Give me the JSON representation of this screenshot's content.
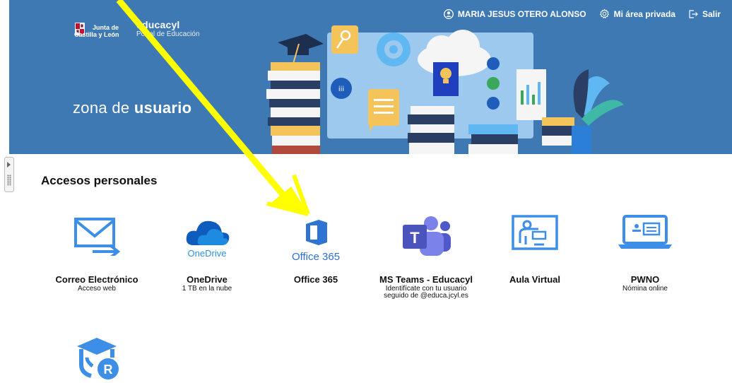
{
  "header": {
    "user_name": "MARIA JESUS OTERO ALONSO",
    "private_area": "Mi área privada",
    "logout": "Salir"
  },
  "logo": {
    "jcyl_line1": "Junta de",
    "jcyl_line2": "Castilla y León",
    "site_name": "educacyl",
    "site_subtitle": "Portal de Educación"
  },
  "zone": {
    "prefix": "zona de",
    "highlight": "usuario"
  },
  "section": {
    "title": "Accesos personales"
  },
  "tiles": [
    {
      "title": "Correo Electrónico",
      "desc": "Acceso web",
      "icon": "mail-forward-icon"
    },
    {
      "title": "OneDrive",
      "desc": "1 TB en la nube",
      "icon": "onedrive-icon",
      "logo_text": "OneDrive"
    },
    {
      "title": "Office 365",
      "desc": "",
      "icon": "office365-icon",
      "logo_text": "Office 365"
    },
    {
      "title": "MS Teams - Educacyl",
      "desc_line1": "Identifícate con tu usuario",
      "desc_line2": "seguido de @educa.jcyl.es",
      "icon": "teams-icon"
    },
    {
      "title": "Aula Virtual",
      "desc": "",
      "icon": "aula-virtual-icon"
    },
    {
      "title": "PWNO",
      "desc": "Nómina online",
      "icon": "pwno-laptop-icon"
    },
    {
      "title": "",
      "desc": "",
      "icon": "graduation-r-icon"
    }
  ],
  "colors": {
    "banner": "#3f79b3",
    "accent_blue": "#2f8fdc",
    "annotation_arrow": "#ffff00"
  }
}
